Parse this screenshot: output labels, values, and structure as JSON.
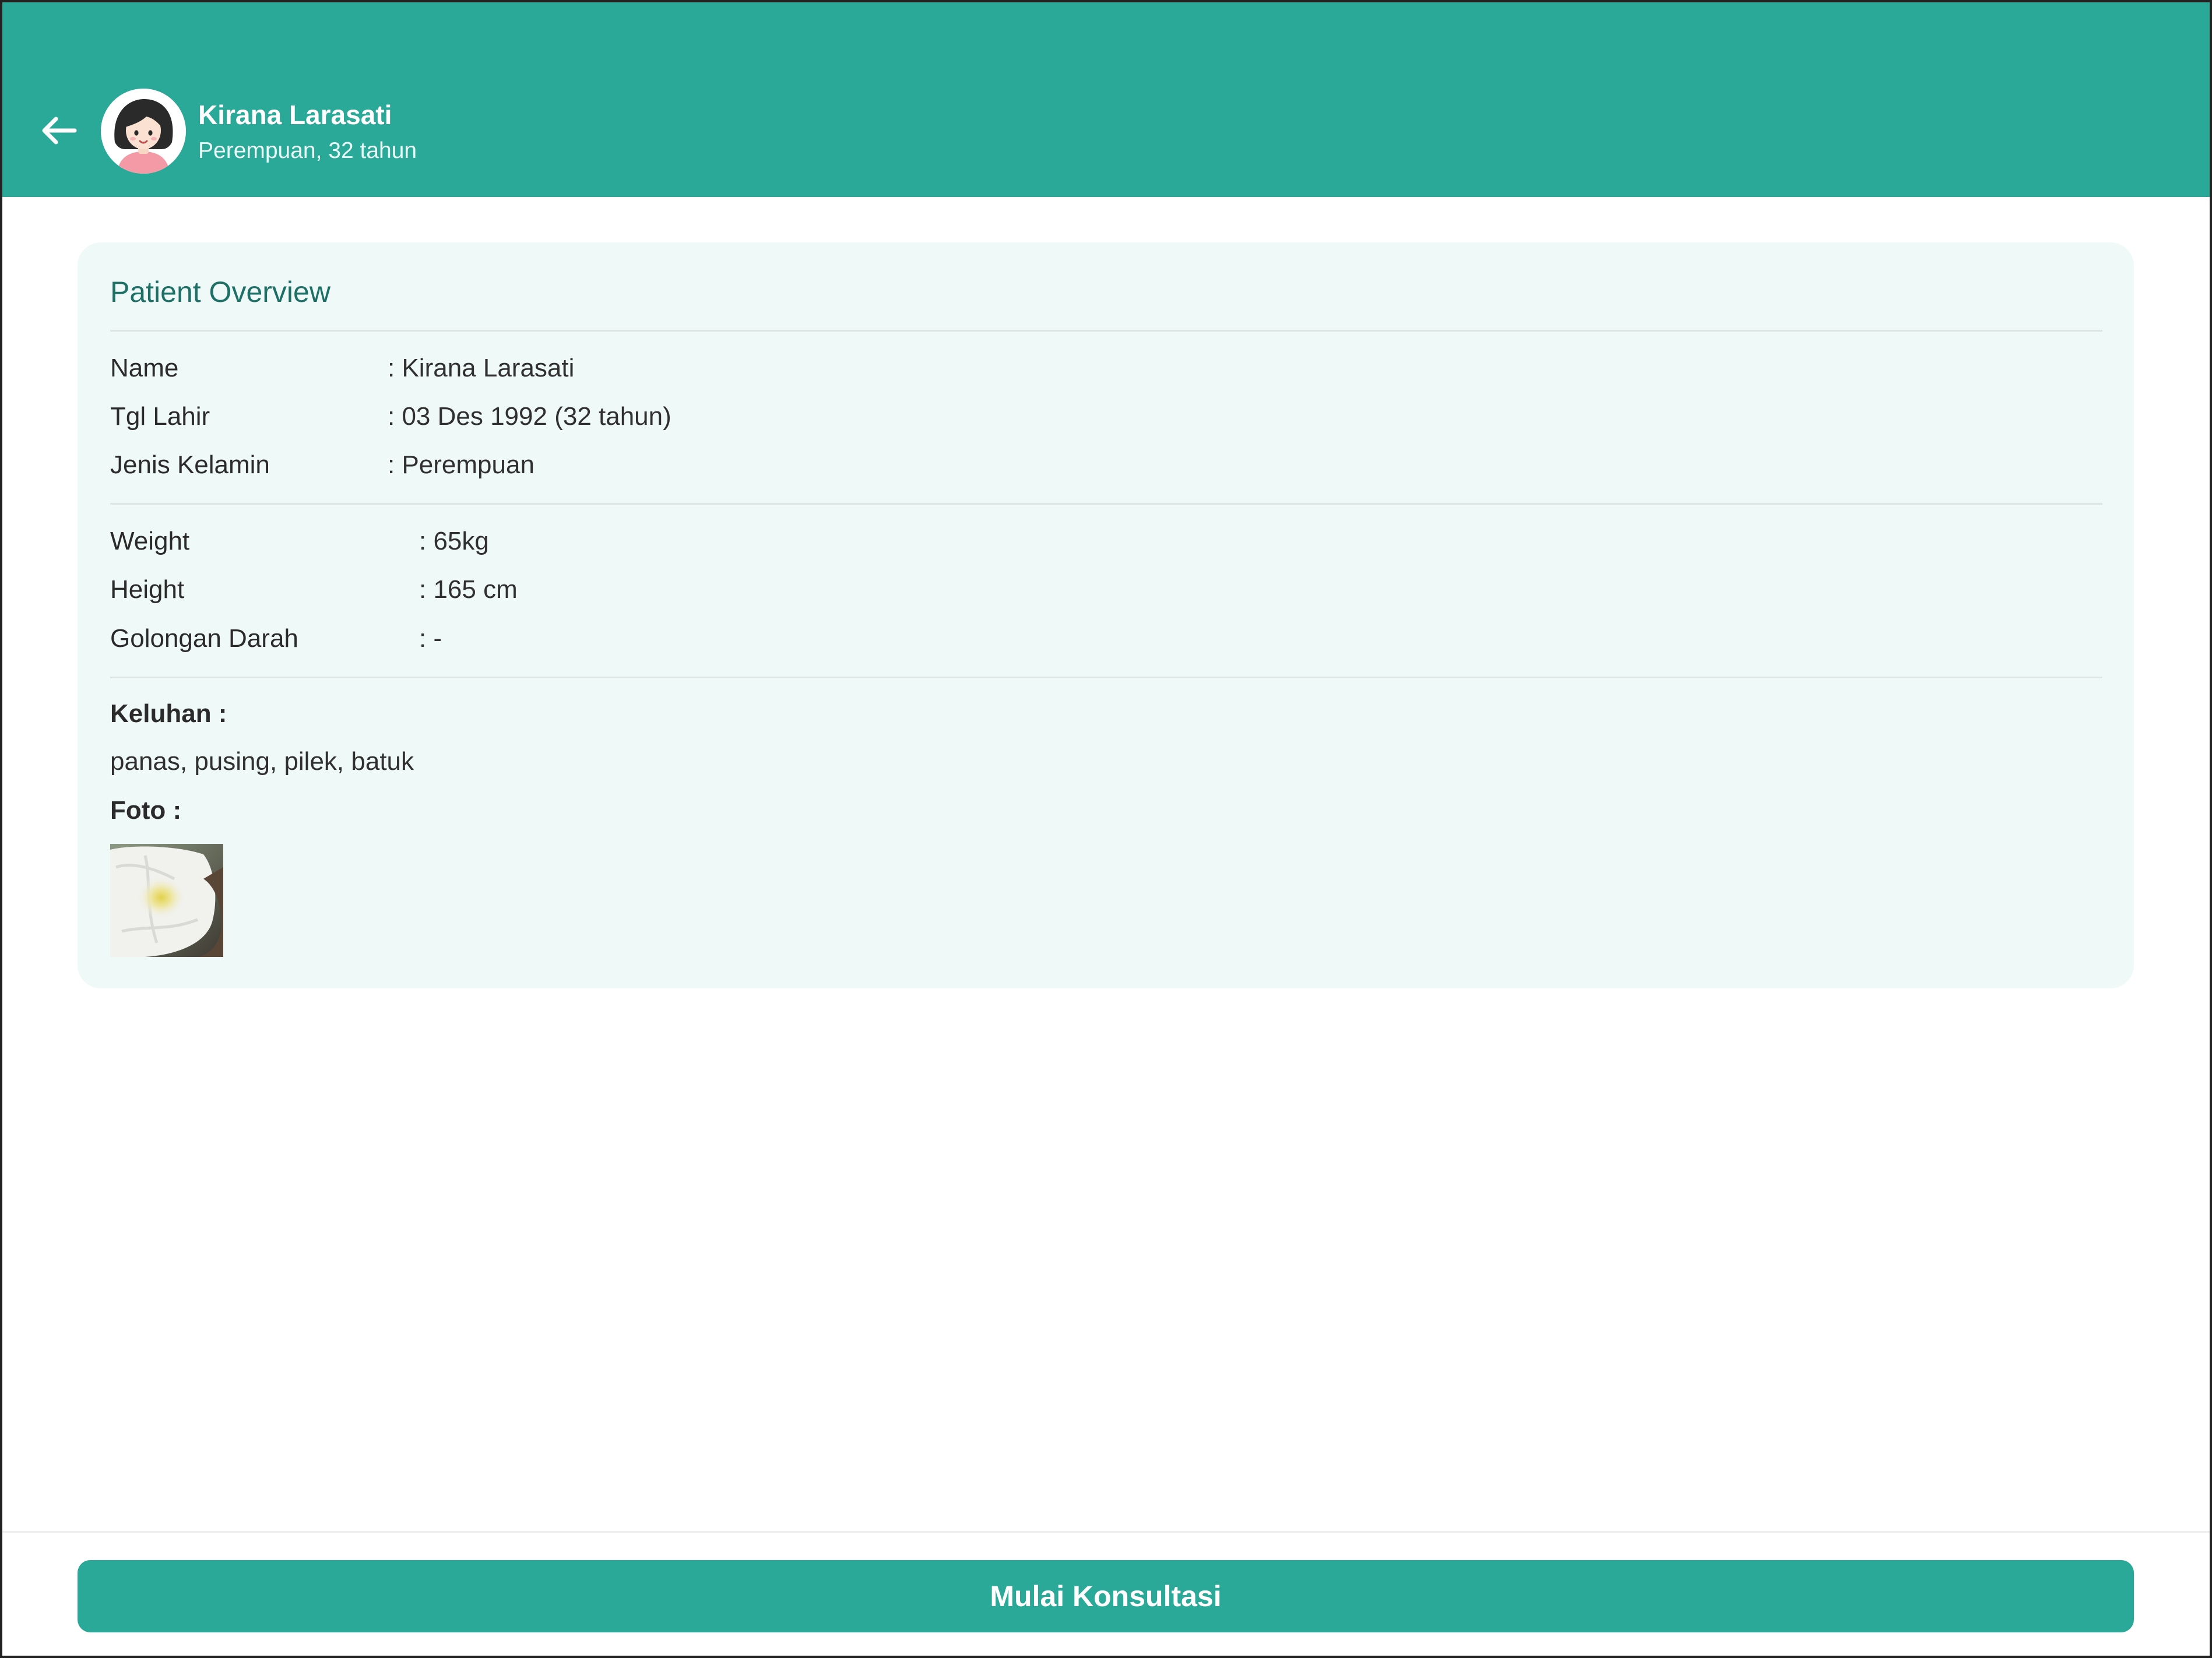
{
  "colors": {
    "accent": "#2aa898",
    "accent_dark": "#1e6f66",
    "card_bg": "#eff9f7"
  },
  "header": {
    "back_icon": "arrow-left-icon",
    "avatar_icon": "female-avatar",
    "name": "Kirana Larasati",
    "subtitle": "Perempuan, 32 tahun"
  },
  "overview": {
    "title": "Patient Overview",
    "identity": [
      {
        "label": "Name",
        "value": ": Kirana Larasati"
      },
      {
        "label": "Tgl Lahir",
        "value": ": 03 Des 1992 (32 tahun)"
      },
      {
        "label": "Jenis Kelamin",
        "value": ": Perempuan"
      }
    ],
    "vitals": [
      {
        "label": "Weight",
        "value": ": 65kg"
      },
      {
        "label": "Height",
        "value": ": 165 cm"
      },
      {
        "label": "Golongan Darah",
        "value": ": -"
      }
    ],
    "complaint_label": "Keluhan :",
    "complaint_text": "panas, pusing, pilek, batuk",
    "photo_label": "Foto :",
    "photo_icon": "tissue-photo-thumbnail"
  },
  "footer": {
    "cta_label": "Mulai Konsultasi"
  }
}
